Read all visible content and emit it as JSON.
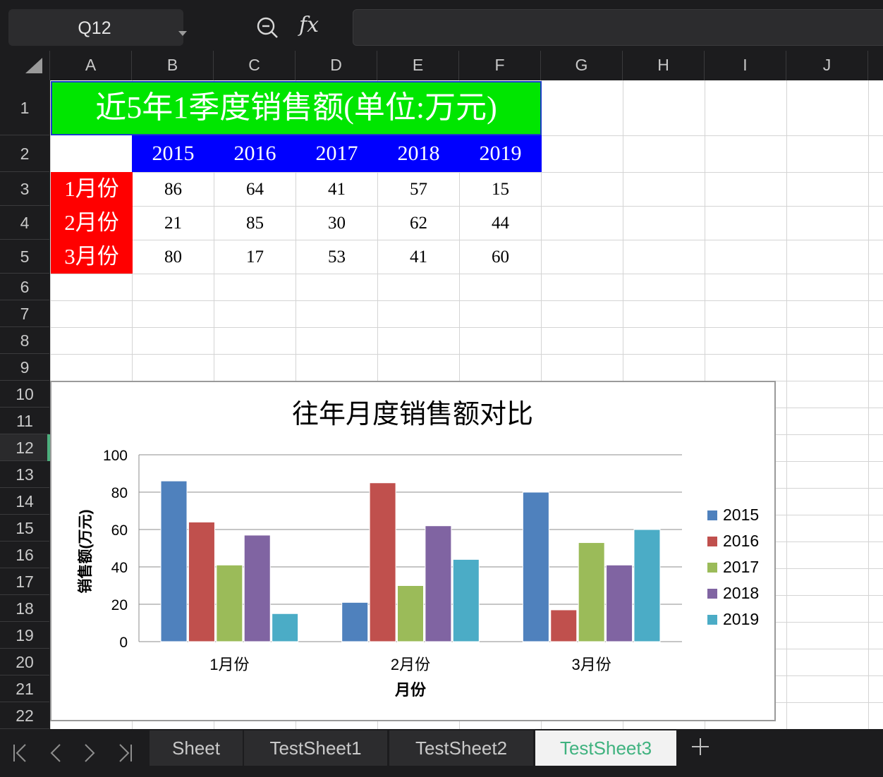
{
  "formula_bar": {
    "cell_reference": "Q12",
    "fx_label": "fx",
    "formula_value": ""
  },
  "columns": [
    "A",
    "B",
    "C",
    "D",
    "E",
    "F",
    "G",
    "H",
    "I",
    "J"
  ],
  "rows": [
    "1",
    "2",
    "3",
    "4",
    "5",
    "6",
    "7",
    "8",
    "9",
    "10",
    "11",
    "12",
    "13",
    "14",
    "15",
    "16",
    "17",
    "18",
    "19",
    "20",
    "21",
    "22"
  ],
  "active_row": "12",
  "sheet": {
    "title": "近5年1季度销售额(单位:万元)",
    "years": [
      "2015",
      "2016",
      "2017",
      "2018",
      "2019"
    ],
    "months": [
      "1月份",
      "2月份",
      "3月份"
    ],
    "values": [
      [
        "86",
        "64",
        "41",
        "57",
        "15"
      ],
      [
        "21",
        "85",
        "30",
        "62",
        "44"
      ],
      [
        "80",
        "17",
        "53",
        "41",
        "60"
      ]
    ]
  },
  "colors": {
    "title_fill": "#00e600",
    "year_header_fill": "#0000ff",
    "month_header_fill": "#ff0000",
    "series": [
      "#4f81bd",
      "#c0504d",
      "#9bbb59",
      "#8064a2",
      "#4bacc6"
    ],
    "active_tab_text": "#3fb27f"
  },
  "chart_data": {
    "type": "bar",
    "title": "往年月度销售额对比",
    "xlabel": "月份",
    "ylabel": "销售额(万元)",
    "categories": [
      "1月份",
      "2月份",
      "3月份"
    ],
    "series": [
      {
        "name": "2015",
        "values": [
          86,
          21,
          80
        ]
      },
      {
        "name": "2016",
        "values": [
          64,
          85,
          17
        ]
      },
      {
        "name": "2017",
        "values": [
          41,
          30,
          53
        ]
      },
      {
        "name": "2018",
        "values": [
          57,
          62,
          41
        ]
      },
      {
        "name": "2019",
        "values": [
          15,
          44,
          60
        ]
      }
    ],
    "ylim": [
      0,
      100
    ],
    "yticks": [
      "0",
      "20",
      "40",
      "60",
      "80",
      "100"
    ],
    "grid": true,
    "legend": "right"
  },
  "tabs": {
    "nav_icons": [
      "first-sheet-icon",
      "prev-sheet-icon",
      "next-sheet-icon",
      "last-sheet-icon"
    ],
    "sheets": [
      "Sheet",
      "TestSheet1",
      "TestSheet2",
      "TestSheet3"
    ],
    "active": "TestSheet3",
    "add_icon": "plus-icon"
  }
}
